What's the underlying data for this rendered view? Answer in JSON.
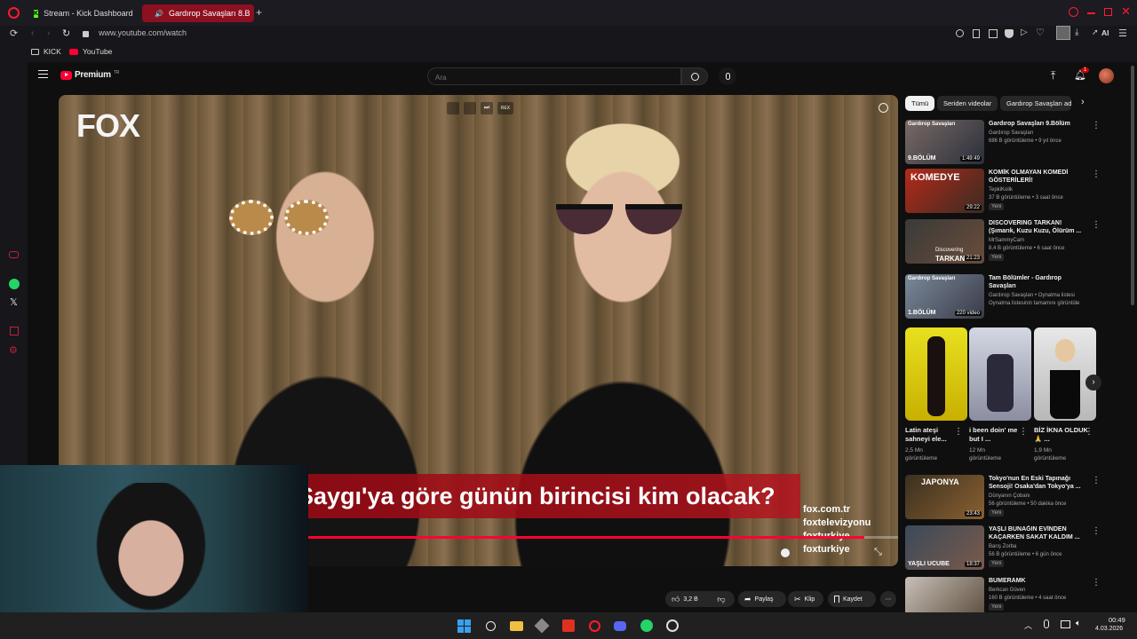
{
  "tabs": [
    {
      "label": "Stream - Kick Dashboard"
    },
    {
      "label": "Gardırop Savaşları 8.B"
    }
  ],
  "address": {
    "url": "www.youtube.com/watch"
  },
  "bookmarks": [
    {
      "label": "KICK"
    },
    {
      "label": "YouTube"
    }
  ],
  "toolbar": {
    "ai_label": "AI"
  },
  "youtube": {
    "logo_text": "Premium",
    "logo_sup": "TR",
    "search_placeholder": "Ara",
    "notification_count": "1"
  },
  "player": {
    "channel_logo": "FOX",
    "caption": "Saygı'ya göre günün birincisi kim olacak?",
    "socials": [
      "fox.com.tr",
      "foxtelevizyonu",
      "foxturkiye",
      "foxturkiye"
    ],
    "speed_badge": "REX"
  },
  "chips": [
    "Tümü",
    "Seriden videolar",
    "Gardırop Savaşları ad"
  ],
  "recommendations": [
    {
      "title": "Gardırop Savaşları 9.Bölüm",
      "channel": "Gardırop Savaşları",
      "meta": "686 B görüntüleme • 9 yıl önce",
      "duration": "1:49:49",
      "thumb_text": "9.BÖLÜM",
      "thumb_top": "Gardırop Savaşları",
      "new": ""
    },
    {
      "title": "KOMİK OLMAYAN KOMEDİ GÖSTERİLERİ!",
      "channel": "TepkiKolik",
      "meta": "37 B görüntüleme • 3 saat önce",
      "duration": "29:22",
      "thumb_text": "KOMEDYE",
      "thumb_top": "",
      "new": "Yeni"
    },
    {
      "title": "DISCOVERING TARKAN! (Şımarık, Kuzu Kuzu, Ölürüm ...",
      "channel": "MrSammyCam",
      "meta": "8,4 B görüntüleme • 6 saat önce",
      "duration": "21:23",
      "thumb_text": "TARKAN",
      "thumb_top": "Discovering",
      "new": "Yeni"
    },
    {
      "title": "Tam Bölümler - Gardırop Savaşları",
      "channel": "Gardırop Savaşları • Oynatma listesi",
      "meta": "Oynatma listesinin tamamını görüntüle",
      "duration": "220 video",
      "thumb_text": "1.BÖLÜM",
      "thumb_top": "Gardırop Savaşları",
      "new": ""
    },
    {
      "title": "Tokyo'nun En Eski Tapınağı Sensoji! Osaka'dan Tokyo'ya ...",
      "channel": "Dünyanın Çobanı",
      "meta": "56 görüntüleme • 50 dakika önce",
      "duration": "23:43",
      "thumb_text": "JAPONYA",
      "thumb_top": "",
      "new": "Yeni"
    },
    {
      "title": "YAŞLI BUNAĞIN EVİNDEN KAÇARKEN SAKAT KALDIM ...",
      "channel": "Barış Zorba",
      "meta": "56 B görüntüleme • 6 gün önce",
      "duration": "18:37",
      "thumb_text": "YAŞLI UCUBE",
      "thumb_top": "",
      "new": "Yeni"
    },
    {
      "title": "BUMERAMK",
      "channel": "Berkcan Güven",
      "meta": "160 B görüntüleme • 4 saat önce",
      "duration": "",
      "thumb_text": "",
      "thumb_top": "",
      "new": "Yeni"
    }
  ],
  "shorts": [
    {
      "title": "Latin ateşi sahneyi ele...",
      "meta1": "2,5 Mn",
      "meta2": "görüntüleme"
    },
    {
      "title": "i been doin' me but I ...",
      "meta1": "12 Mn",
      "meta2": "görüntüleme"
    },
    {
      "title": "BİZ İKNA OLDUK🙏 ...",
      "meta1": "1,9 Mn",
      "meta2": "görüntüleme"
    }
  ],
  "actions": {
    "likes": "3,2 B",
    "share": "Paylaş",
    "clip": "Klip",
    "save": "Kaydet"
  },
  "taskbar": {
    "time": "00:49",
    "date": "4.03.2026"
  },
  "colors": {
    "youtube_red": "#ff0033",
    "opera_red": "#ff1b2d",
    "chip_bg": "#272727"
  }
}
